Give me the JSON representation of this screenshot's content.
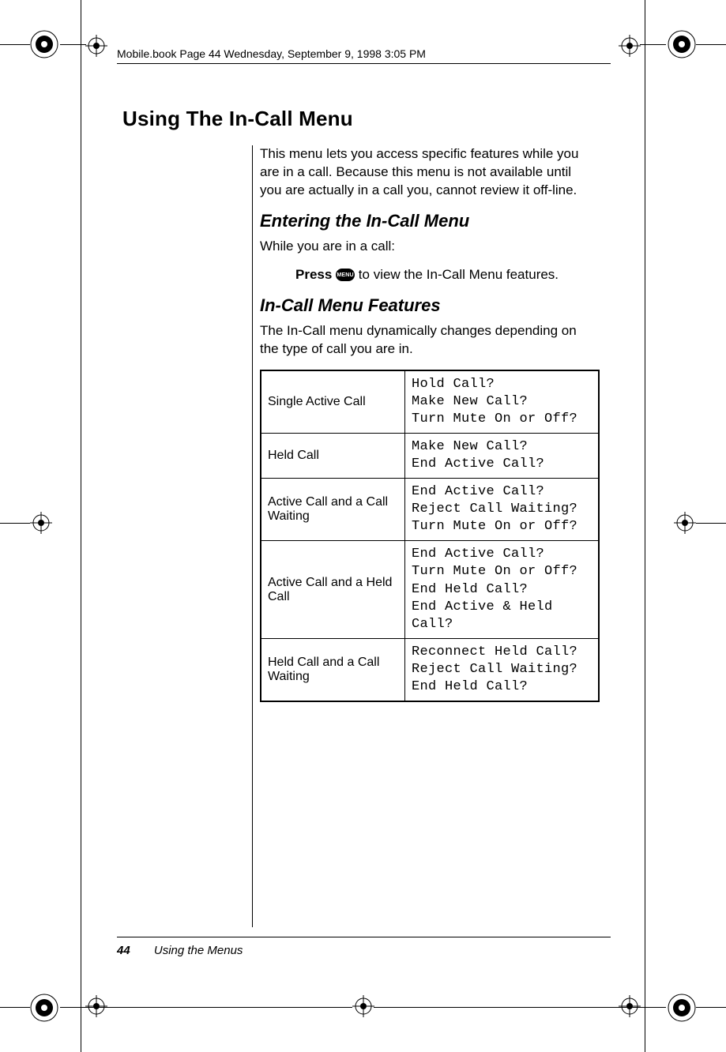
{
  "doc_header": "Mobile.book  Page 44  Wednesday, September 9, 1998  3:05 PM",
  "title": "Using The In-Call Menu",
  "intro": "This menu lets you access specific features while you are in a call. Because this menu is not available until you are actually in a call you, cannot review it off-line.",
  "section1": {
    "heading": "Entering the In-Call Menu",
    "line1": "While you are in a call:",
    "press_word": "Press",
    "menu_label": "MENU",
    "press_tail": " to view the In-Call Menu features."
  },
  "section2": {
    "heading": "In-Call Menu Features",
    "intro": "The In-Call menu dynamically changes depending on the type of call you are in."
  },
  "table": {
    "rows": [
      {
        "left": "Single Active Call",
        "right": "Hold Call?\nMake New Call?\nTurn Mute On or Off?"
      },
      {
        "left": "Held Call",
        "right": "Make New Call?\nEnd Active Call?"
      },
      {
        "left": "Active Call and a Call Waiting",
        "right": "End Active Call?\nReject Call Waiting?\nTurn Mute On or Off?"
      },
      {
        "left": "Active Call and a Held Call",
        "right": "End Active Call?\nTurn Mute On or Off?\nEnd Held Call?\nEnd Active & Held Call?"
      },
      {
        "left": "Held Call and a Call Waiting",
        "right": "Reconnect Held Call?\nReject Call Waiting?\nEnd Held Call?"
      }
    ]
  },
  "footer": {
    "page": "44",
    "section": "Using the Menus"
  }
}
